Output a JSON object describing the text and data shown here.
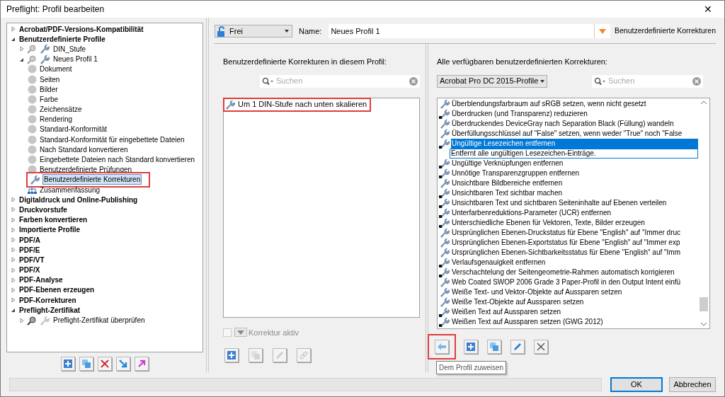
{
  "window": {
    "title": "Preflight: Profil bearbeiten",
    "close": "✕"
  },
  "tree": [
    {
      "label": "Acrobat/PDF-Versions-Kompatibilität",
      "kind": "group",
      "expanded": false,
      "selected": false
    },
    {
      "label": "Benutzerdefinierte Profile",
      "kind": "group",
      "expanded": true,
      "selected": false,
      "children": [
        {
          "label": "DIN_Stufe",
          "kind": "profile",
          "expanded": false,
          "selected": false
        },
        {
          "label": "Neues Profil 1",
          "kind": "profile",
          "expanded": true,
          "selected": false,
          "children": [
            {
              "label": "Dokument",
              "kind": "category",
              "selected": false
            },
            {
              "label": "Seiten",
              "kind": "category",
              "selected": false
            },
            {
              "label": "Bilder",
              "kind": "category",
              "selected": false
            },
            {
              "label": "Farbe",
              "kind": "category",
              "selected": false
            },
            {
              "label": "Zeichensätze",
              "kind": "category",
              "selected": false
            },
            {
              "label": "Rendering",
              "kind": "category",
              "selected": false
            },
            {
              "label": "Standard-Konformität",
              "kind": "category",
              "selected": false
            },
            {
              "label": "Standard-Konformität für eingebettete Dateien",
              "kind": "category",
              "selected": false
            },
            {
              "label": "Nach Standard konvertieren",
              "kind": "category",
              "selected": false
            },
            {
              "label": "Eingebettete Dateien nach Standard konvertieren",
              "kind": "category",
              "selected": false
            },
            {
              "label": "Benutzerdefinierte Prüfungen",
              "kind": "category",
              "selected": false
            },
            {
              "label": "Benutzerdefinierte Korrekturen",
              "kind": "fixup",
              "selected": true,
              "marked": true
            },
            {
              "label": "Zusammenfassung",
              "kind": "summary",
              "selected": false
            }
          ]
        }
      ]
    },
    {
      "label": "Digitaldruck und Online-Publishing",
      "kind": "group",
      "expanded": false,
      "selected": false
    },
    {
      "label": "Druckvorstufe",
      "kind": "group",
      "expanded": false,
      "selected": false
    },
    {
      "label": "Farben konvertieren",
      "kind": "group",
      "expanded": false,
      "selected": false
    },
    {
      "label": "Importierte Profile",
      "kind": "group",
      "expanded": false,
      "selected": false
    },
    {
      "label": "PDF/A",
      "kind": "group",
      "expanded": false,
      "selected": false
    },
    {
      "label": "PDF/E",
      "kind": "group",
      "expanded": false,
      "selected": false
    },
    {
      "label": "PDF/VT",
      "kind": "group",
      "expanded": false,
      "selected": false
    },
    {
      "label": "PDF/X",
      "kind": "group",
      "expanded": false,
      "selected": false
    },
    {
      "label": "PDF-Analyse",
      "kind": "group",
      "expanded": false,
      "selected": false
    },
    {
      "label": "PDF-Ebenen erzeugen",
      "kind": "group",
      "expanded": false,
      "selected": false
    },
    {
      "label": "PDF-Korrekturen",
      "kind": "group",
      "expanded": false,
      "selected": false
    },
    {
      "label": "Preflight-Zertifikat",
      "kind": "group",
      "expanded": true,
      "selected": false,
      "children": [
        {
          "label": "Preflight-Zertifikat überprüfen",
          "kind": "locked-profile",
          "expanded": false,
          "selected": false
        }
      ]
    }
  ],
  "tree_buttons": [
    {
      "kind": "plus",
      "disabled": false
    },
    {
      "kind": "copy",
      "disabled": false
    },
    {
      "kind": "delete",
      "disabled": false
    },
    {
      "kind": "import",
      "disabled": false
    },
    {
      "kind": "export",
      "disabled": false
    }
  ],
  "header": {
    "lock_dropdown": "Frei",
    "name_label": "Name:",
    "name_value": "Neues Profil 1",
    "section": "Benutzerdefinierte Korrekturen"
  },
  "profile_fixups": {
    "heading": "Benutzerdefinierte Korrekturen in diesem Profil:",
    "search": {
      "placeholder": "Suchen"
    },
    "items": [
      {
        "label": "Um 1 DIN-Stufe nach unten skalieren",
        "selected": false,
        "marked": true
      }
    ],
    "active_checkbox": {
      "label": "Korrektur aktiv",
      "checked": false,
      "disabled": true
    },
    "buttons": [
      {
        "kind": "plus",
        "disabled": false
      },
      {
        "kind": "copy",
        "disabled": true
      },
      {
        "kind": "pencil",
        "disabled": true
      },
      {
        "kind": "link",
        "disabled": true
      }
    ]
  },
  "available_fixups": {
    "heading": "Alle verfügbaren benutzerdefinierten Korrekturen:",
    "library": "Acrobat Pro DC 2015-Profile",
    "search": {
      "placeholder": "Suchen"
    },
    "items": [
      {
        "label": "Überblendungsfarbraum auf sRGB setzen, wenn nicht gesetzt",
        "locked": false,
        "selected": false
      },
      {
        "label": "Überdrucken (und Transparenz) reduzieren",
        "locked": true,
        "selected": false
      },
      {
        "label": "Überdruckendes DeviceGray nach Separation Black (Füllung) wandeln",
        "locked": false,
        "selected": false
      },
      {
        "label": "Überfüllungsschlüssel auf \"False\" setzen, wenn weder \"True\" noch \"False",
        "locked": false,
        "selected": false
      },
      {
        "label": "Ungültige Lesezeichen entfernen",
        "locked": true,
        "selected": true,
        "description": "Entfernt alle ungültigen Lesezeichen-Einträge."
      },
      {
        "label": "Ungültige Verknüpfungen entfernen",
        "locked": true,
        "selected": false
      },
      {
        "label": "Unnötige Transparenzgruppen entfernen",
        "locked": true,
        "selected": false
      },
      {
        "label": "Unsichtbare Bildbereiche entfernen",
        "locked": false,
        "selected": false
      },
      {
        "label": "Unsichtbaren Text sichtbar machen",
        "locked": true,
        "selected": false
      },
      {
        "label": "Unsichtbaren Text und sichtbaren Seiteninhalte auf Ebenen verteilen",
        "locked": true,
        "selected": false
      },
      {
        "label": "Unterfarbenreduktions-Parameter (UCR) entfernen",
        "locked": true,
        "selected": false
      },
      {
        "label": "Unterschiedliche Ebenen für Vektoren, Texte, Bilder erzeugen",
        "locked": true,
        "selected": false
      },
      {
        "label": "Ursprünglichen Ebenen-Druckstatus für Ebene \"English\" auf \"Immer druc",
        "locked": false,
        "selected": false
      },
      {
        "label": "Ursprünglichen Ebenen-Exportstatus für Ebene \"English\" auf \"Immer exp",
        "locked": false,
        "selected": false
      },
      {
        "label": "Ursprünglichen Ebenen-Sichtbarkeitsstatus für Ebene \"English\" auf \"Imm",
        "locked": false,
        "selected": false
      },
      {
        "label": "Verlaufsgenauigkeit entfernen",
        "locked": true,
        "selected": false
      },
      {
        "label": "Verschachtelung der Seitengeometrie-Rahmen automatisch korrigieren",
        "locked": true,
        "selected": false
      },
      {
        "label": "Web Coated SWOP 2006 Grade 3 Paper-Profil in den Output Intent einfü",
        "locked": false,
        "selected": false
      },
      {
        "label": "Weiße Text- und Vektor-Objekte auf Aussparen setzen",
        "locked": false,
        "selected": false
      },
      {
        "label": "Weiße Text-Objekte auf Aussparen setzen",
        "locked": false,
        "selected": false
      },
      {
        "label": "Weißen Text auf Aussparen setzen",
        "locked": true,
        "selected": false
      },
      {
        "label": "Weißen Text auf Aussparen setzen (GWG 2012)",
        "locked": true,
        "selected": false
      }
    ],
    "buttons": [
      {
        "kind": "assign",
        "disabled": false,
        "marked": true,
        "tooltip": "Dem Profil zuweisen"
      },
      {
        "kind": "plus",
        "disabled": false
      },
      {
        "kind": "copy",
        "disabled": false
      },
      {
        "kind": "pencil",
        "disabled": false
      },
      {
        "kind": "x",
        "disabled": false
      }
    ]
  },
  "footer": {
    "buttons": [
      "OK",
      "Abbrechen"
    ]
  }
}
